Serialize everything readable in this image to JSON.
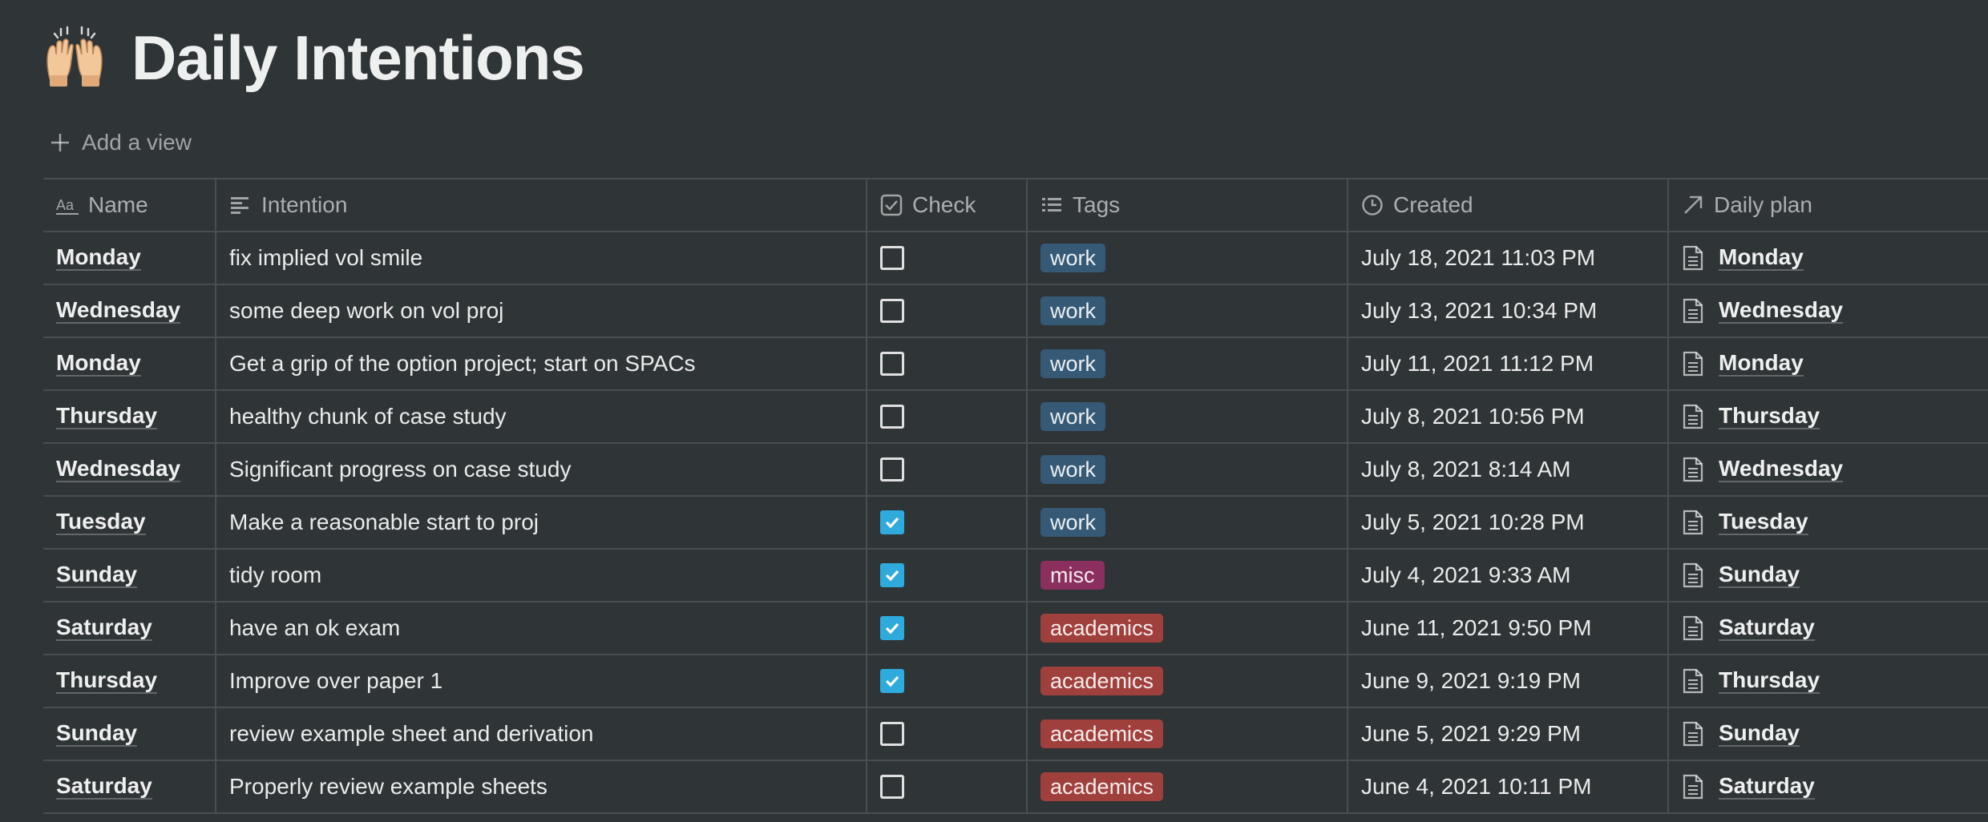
{
  "page": {
    "title": "Daily Intentions",
    "icon": "raising-hands-emoji",
    "add_view_label": "Add a view"
  },
  "colors": {
    "background": "#2f3437",
    "checkbox_checked": "#2eaadc",
    "tag_work": "#365976",
    "tag_misc": "#8b2f5f",
    "tag_academics": "#a0403d"
  },
  "table": {
    "columns": [
      {
        "key": "name",
        "label": "Name",
        "icon": "text-aa-icon"
      },
      {
        "key": "intention",
        "label": "Intention",
        "icon": "text-lines-icon"
      },
      {
        "key": "check",
        "label": "Check",
        "icon": "checkbox-icon"
      },
      {
        "key": "tags",
        "label": "Tags",
        "icon": "list-icon"
      },
      {
        "key": "created",
        "label": "Created",
        "icon": "clock-icon"
      },
      {
        "key": "plan",
        "label": "Daily plan",
        "icon": "relation-arrow-icon"
      }
    ],
    "rows": [
      {
        "name": "Monday",
        "intention": "fix implied vol smile",
        "checked": false,
        "tag": "work",
        "created": "July 18, 2021 11:03 PM",
        "plan": "Monday"
      },
      {
        "name": "Wednesday",
        "intention": "some deep work on vol proj",
        "checked": false,
        "tag": "work",
        "created": "July 13, 2021 10:34 PM",
        "plan": "Wednesday"
      },
      {
        "name": "Monday",
        "intention": "Get a grip of the option project; start on SPACs",
        "checked": false,
        "tag": "work",
        "created": "July 11, 2021 11:12 PM",
        "plan": "Monday"
      },
      {
        "name": "Thursday",
        "intention": "healthy chunk of case study",
        "checked": false,
        "tag": "work",
        "created": "July 8, 2021 10:56 PM",
        "plan": "Thursday"
      },
      {
        "name": "Wednesday",
        "intention": "Significant progress on case study",
        "checked": false,
        "tag": "work",
        "created": "July 8, 2021 8:14 AM",
        "plan": "Wednesday"
      },
      {
        "name": "Tuesday",
        "intention": "Make a reasonable start to proj",
        "checked": true,
        "tag": "work",
        "created": "July 5, 2021 10:28 PM",
        "plan": "Tuesday"
      },
      {
        "name": "Sunday",
        "intention": "tidy room",
        "checked": true,
        "tag": "misc",
        "created": "July 4, 2021 9:33 AM",
        "plan": "Sunday"
      },
      {
        "name": "Saturday",
        "intention": "have an ok exam",
        "checked": true,
        "tag": "academics",
        "created": "June 11, 2021 9:50 PM",
        "plan": "Saturday"
      },
      {
        "name": "Thursday",
        "intention": "Improve over paper 1",
        "checked": true,
        "tag": "academics",
        "created": "June 9, 2021 9:19 PM",
        "plan": "Thursday"
      },
      {
        "name": "Sunday",
        "intention": "review example sheet and derivation",
        "checked": false,
        "tag": "academics",
        "created": "June 5, 2021 9:29 PM",
        "plan": "Sunday"
      },
      {
        "name": "Saturday",
        "intention": "Properly review example sheets",
        "checked": false,
        "tag": "academics",
        "created": "June 4, 2021 10:11 PM",
        "plan": "Saturday"
      }
    ]
  }
}
